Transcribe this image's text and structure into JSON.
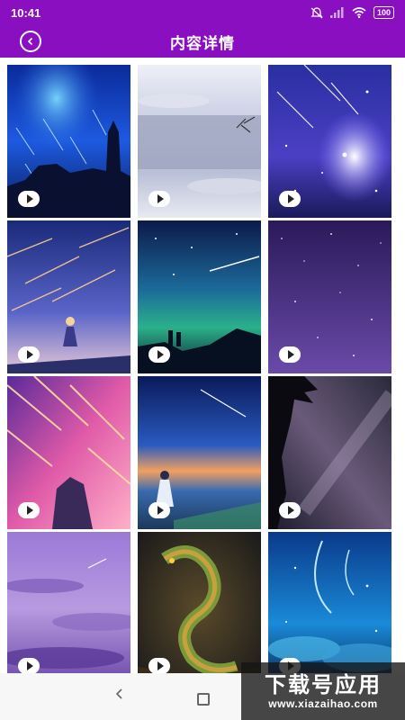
{
  "status_bar": {
    "time": "10:41",
    "battery": "100"
  },
  "header": {
    "title": "内容详情"
  },
  "tiles": [
    {
      "scene": "meteor shower over castle"
    },
    {
      "scene": "misty evening sky"
    },
    {
      "scene": "galaxy with shooting stars"
    },
    {
      "scene": "girl under meteor shower"
    },
    {
      "scene": "couple under aurora night sky"
    },
    {
      "scene": "purple starry sky"
    },
    {
      "scene": "pink meteor rain hand"
    },
    {
      "scene": "girl by the sea at dusk"
    },
    {
      "scene": "milky way with palm tree"
    },
    {
      "scene": "purple cloudy sky"
    },
    {
      "scene": "golden dragon"
    },
    {
      "scene": "blue starry clouds"
    }
  ],
  "watermark": {
    "main": "下载号应用",
    "sub": "www.xiazaihao.com"
  },
  "colors": {
    "accent": "#8a0fc0"
  }
}
